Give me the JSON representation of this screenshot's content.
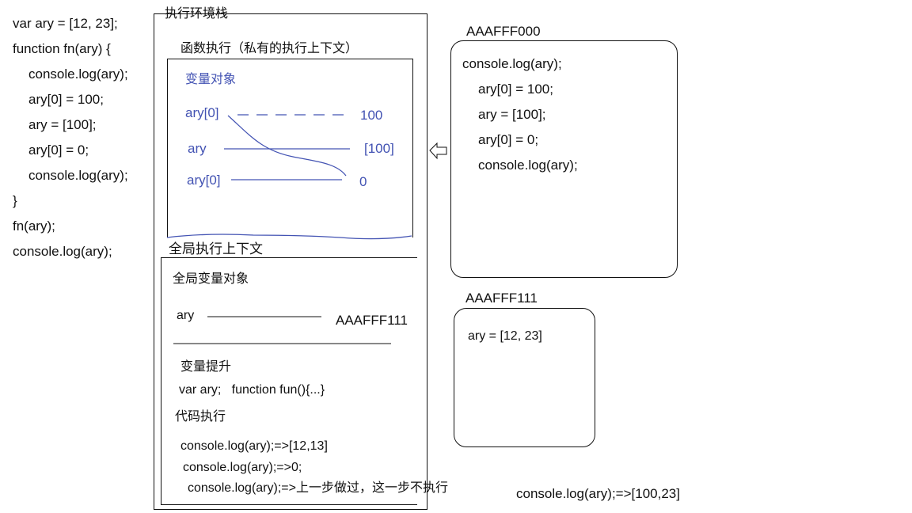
{
  "code": [
    "var ary = [12, 23];",
    "function fn(ary) {",
    "console.log(ary);",
    "ary[0] = 100;",
    "ary = [100];",
    "ary[0] = 0;",
    "console.log(ary);",
    "}",
    "fn(ary);",
    "console.log(ary);"
  ],
  "stack": {
    "title": "执行环境栈",
    "fn_context": {
      "title": "函数执行（私有的执行上下文）",
      "vo_title": "变量对象",
      "rows": [
        {
          "name": "ary[0]",
          "value": "100"
        },
        {
          "name": "ary",
          "value": "[100]"
        },
        {
          "name": "ary[0]",
          "value": "0"
        }
      ]
    },
    "global_context": {
      "title": "全局执行上下文",
      "vo_title": "全局变量对象",
      "var_name": "ary",
      "var_value": "AAAFFF111",
      "hoist_title": "变量提升",
      "hoist_text": "var ary;   function fun(){...}",
      "exec_title": "代码执行",
      "exec_lines": [
        "console.log(ary);=>[12,13]",
        "console.log(ary);=>0;",
        "console.log(ary);=>上一步做过，这一步不执行"
      ]
    }
  },
  "heap_a": {
    "label": "AAAFFF000",
    "lines": [
      "console.log(ary);",
      "ary[0] = 100;",
      "ary = [100];",
      "ary[0] = 0;",
      "console.log(ary);"
    ]
  },
  "heap_b": {
    "label": "AAAFFF111",
    "content": "ary = [12, 23]"
  },
  "bottom_note": "console.log(ary);=>[100,23]",
  "colors": {
    "ink": "#111111",
    "pen_blue": "#4353b3"
  }
}
